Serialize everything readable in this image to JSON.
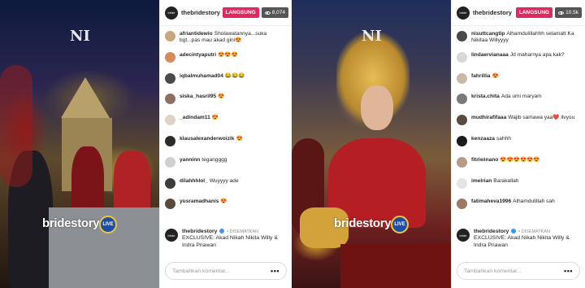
{
  "left": {
    "watermark_logo": "NI",
    "watermark_text": "bridestory",
    "badge_text": "LIVE",
    "header": {
      "username": "thebridestory",
      "live": "LANGSUNG",
      "viewers": "8,074"
    },
    "comments": [
      {
        "user": "afriantidewio",
        "text": "Sholawatannya...suka bgt...pas mau akad gini😍",
        "color": "#c9a77c"
      },
      {
        "user": "adecintyaputri",
        "text": "😍😍😍",
        "color": "#d78a5a"
      },
      {
        "user": "iqbalmuhamad04",
        "text": "😂😂😂",
        "color": "#4a4a4a"
      },
      {
        "user": "siska_hasril95",
        "text": "😍",
        "color": "#8c6f62"
      },
      {
        "user": "_adindam11",
        "text": "😍",
        "color": "#e0d2c4"
      },
      {
        "user": "klausalexanderwoizik",
        "text": "😍",
        "color": "#2b2b2b"
      },
      {
        "user": "yanninn",
        "text": "tegangggg",
        "color": "#cfcfcf"
      },
      {
        "user": "dilahhhlol_",
        "text": "Wuyyyy ade",
        "color": "#3d3d3d"
      },
      {
        "user": "yusramadhanis",
        "text": "😍",
        "color": "#5a4a3a"
      }
    ],
    "caption": {
      "user": "thebridestory",
      "pinned": "• DISEMATKAN",
      "text": "EXCLUSIVE: Akad Nikah Nikita Willy & Indra Priawan"
    },
    "input_placeholder": "Tambahkan komentar...",
    "more_label": "•••"
  },
  "right": {
    "watermark_logo": "NI",
    "watermark_text": "bridestory",
    "badge_text": "LIVE",
    "header": {
      "username": "thebridestory",
      "live": "LANGSUNG",
      "viewers": "10.5k"
    },
    "comments": [
      {
        "user": "nisuttcangtip",
        "text": "Alhamdulillahhh selamatt Ka Nikitaa Willyyyy",
        "color": "#4a4a4a"
      },
      {
        "user": "lindaervianaaa",
        "text": "Jd maharnya apa kak?",
        "color": "#d8d8d8"
      },
      {
        "user": "fahrillia",
        "text": "😍",
        "color": "#c7b8a8"
      },
      {
        "user": "krista.chita",
        "text": "Ada umi maryam",
        "color": "#7a7a7a"
      },
      {
        "user": "mudhirafifaaa",
        "text": "Wajib samawa yaa❤️ ilvyou",
        "color": "#5b4c42"
      },
      {
        "user": "kenzaaza",
        "text": "sahhh",
        "color": "#1a1a1a"
      },
      {
        "user": "fitriwinano",
        "text": "😍😍😍😍😍😍",
        "color": "#b39c88"
      },
      {
        "user": "imelrian",
        "text": "Barakallah",
        "color": "#e4e4e4"
      },
      {
        "user": "fatimaheva1996",
        "text": "Alhamdulillah sah",
        "color": "#9c7a66"
      }
    ],
    "caption": {
      "user": "thebridestory",
      "pinned": "• DISEMATKAN",
      "text": "EXCLUSIVE: Akad Nikah Nikita Willy & Indra Priawan"
    },
    "input_placeholder": "Tambahkan komentar...",
    "more_label": "•••"
  }
}
